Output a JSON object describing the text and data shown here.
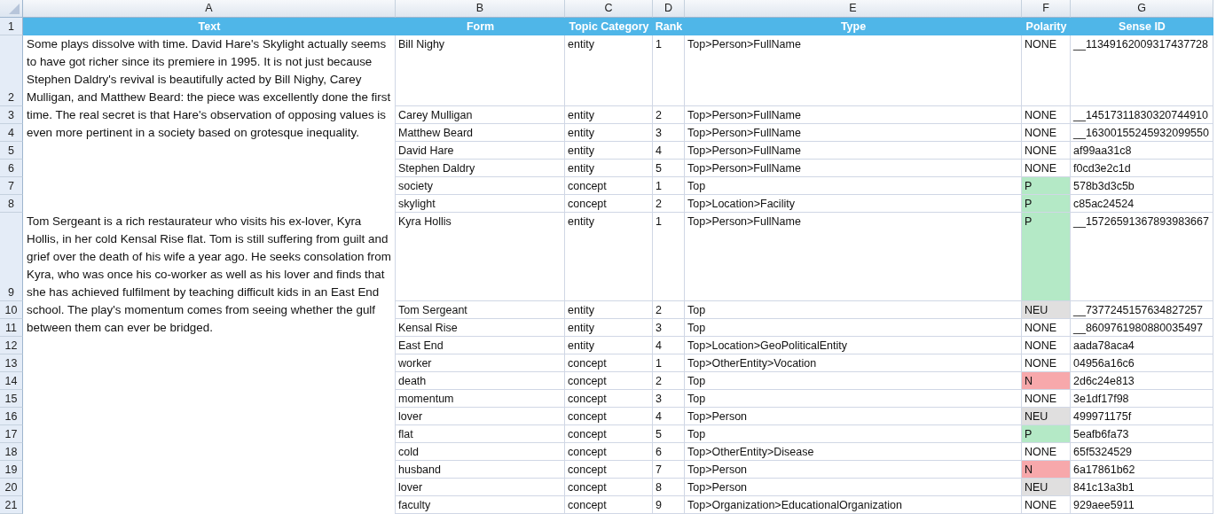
{
  "columns": [
    {
      "letter": "A",
      "heading": "Text"
    },
    {
      "letter": "B",
      "heading": "Form"
    },
    {
      "letter": "C",
      "heading": "Topic Category"
    },
    {
      "letter": "D",
      "heading": "Rank"
    },
    {
      "letter": "E",
      "heading": "Type"
    },
    {
      "letter": "F",
      "heading": "Polarity"
    },
    {
      "letter": "G",
      "heading": "Sense ID"
    }
  ],
  "header_row": "1",
  "passages": [
    {
      "text": "Some plays dissolve with time. David Hare's Skylight actually seems to have got richer since its premiere in 1995. It is not just because Stephen Daldry's revival is beautifully acted by Bill Nighy, Carey Mulligan, and Matthew Beard: the piece was excellently done the first time. The real secret is that Hare's observation of opposing values is even more pertinent in a society based on grotesque inequality.",
      "entries": [
        {
          "row": "2",
          "form": "Bill Nighy",
          "category": "entity",
          "rank": "1",
          "type": "Top>Person>FullName",
          "polarity": "NONE",
          "sense_id": "__11349162009317437728"
        },
        {
          "row": "3",
          "form": "Carey Mulligan",
          "category": "entity",
          "rank": "2",
          "type": "Top>Person>FullName",
          "polarity": "NONE",
          "sense_id": "__14517311830320744910"
        },
        {
          "row": "4",
          "form": "Matthew Beard",
          "category": "entity",
          "rank": "3",
          "type": "Top>Person>FullName",
          "polarity": "NONE",
          "sense_id": "__16300155245932099550"
        },
        {
          "row": "5",
          "form": "David Hare",
          "category": "entity",
          "rank": "4",
          "type": "Top>Person>FullName",
          "polarity": "NONE",
          "sense_id": "af99aa31c8"
        },
        {
          "row": "6",
          "form": "Stephen Daldry",
          "category": "entity",
          "rank": "5",
          "type": "Top>Person>FullName",
          "polarity": "NONE",
          "sense_id": "f0cd3e2c1d"
        },
        {
          "row": "7",
          "form": "society",
          "category": "concept",
          "rank": "1",
          "type": "Top",
          "polarity": "P",
          "color": "#b4e9c6",
          "sense_id": "578b3d3c5b"
        },
        {
          "row": "8",
          "form": "skylight",
          "category": "concept",
          "rank": "2",
          "type": "Top>Location>Facility",
          "polarity": "P",
          "color": "#b4e9c6",
          "sense_id": "c85ac24524"
        }
      ]
    },
    {
      "text": "Tom Sergeant is a rich restaurateur who visits his ex-lover, Kyra Hollis, in her cold Kensal Rise flat. Tom is still suffering from guilt and grief over the death of his wife a year ago. He seeks consolation from Kyra, who was once his co-worker as well as his lover and finds that she has achieved fulfilment by teaching difficult kids in an East End school. The play's momentum comes from seeing whether the gulf between them can ever be bridged.",
      "entries": [
        {
          "row": "9",
          "form": "Kyra Hollis",
          "category": "entity",
          "rank": "1",
          "type": "Top>Person>FullName",
          "polarity": "P",
          "color": "#b4e9c6",
          "sense_id": "__15726591367893983667"
        },
        {
          "row": "10",
          "form": "Tom Sergeant",
          "category": "entity",
          "rank": "2",
          "type": "Top",
          "polarity": "NEU",
          "color": "#e0dfdf",
          "sense_id": "__7377245157634827257"
        },
        {
          "row": "11",
          "form": "Kensal Rise",
          "category": "entity",
          "rank": "3",
          "type": "Top",
          "polarity": "NONE",
          "sense_id": "__8609761980880035497"
        },
        {
          "row": "12",
          "form": "East End",
          "category": "entity",
          "rank": "4",
          "type": "Top>Location>GeoPoliticalEntity",
          "polarity": "NONE",
          "sense_id": "aada78aca4"
        },
        {
          "row": "13",
          "form": "worker",
          "category": "concept",
          "rank": "1",
          "type": "Top>OtherEntity>Vocation",
          "polarity": "NONE",
          "sense_id": "04956a16c6"
        },
        {
          "row": "14",
          "form": "death",
          "category": "concept",
          "rank": "2",
          "type": "Top",
          "polarity": "N",
          "color": "#f7a8ab",
          "sense_id": "2d6c24e813"
        },
        {
          "row": "15",
          "form": "momentum",
          "category": "concept",
          "rank": "3",
          "type": "Top",
          "polarity": "NONE",
          "sense_id": "3e1df17f98"
        },
        {
          "row": "16",
          "form": "lover",
          "category": "concept",
          "rank": "4",
          "type": "Top>Person",
          "polarity": "NEU",
          "color": "#e0dfdf",
          "sense_id": "499971175f"
        },
        {
          "row": "17",
          "form": "flat",
          "category": "concept",
          "rank": "5",
          "type": "Top",
          "polarity": "P",
          "color": "#b4e9c6",
          "sense_id": "5eafb6fa73"
        },
        {
          "row": "18",
          "form": "cold",
          "category": "concept",
          "rank": "6",
          "type": "Top>OtherEntity>Disease",
          "polarity": "NONE",
          "sense_id": "65f5324529"
        },
        {
          "row": "19",
          "form": "husband",
          "category": "concept",
          "rank": "7",
          "type": "Top>Person",
          "polarity": "N",
          "color": "#f7a8ab",
          "sense_id": "6a17861b62"
        },
        {
          "row": "20",
          "form": "lover",
          "category": "concept",
          "rank": "8",
          "type": "Top>Person",
          "polarity": "NEU",
          "color": "#e0dfdf",
          "sense_id": "841c13a3b1"
        },
        {
          "row": "21",
          "form": "faculty",
          "category": "concept",
          "rank": "9",
          "type": "Top>Organization>EducationalOrganization",
          "polarity": "NONE",
          "sense_id": "929aee5911"
        }
      ]
    }
  ]
}
